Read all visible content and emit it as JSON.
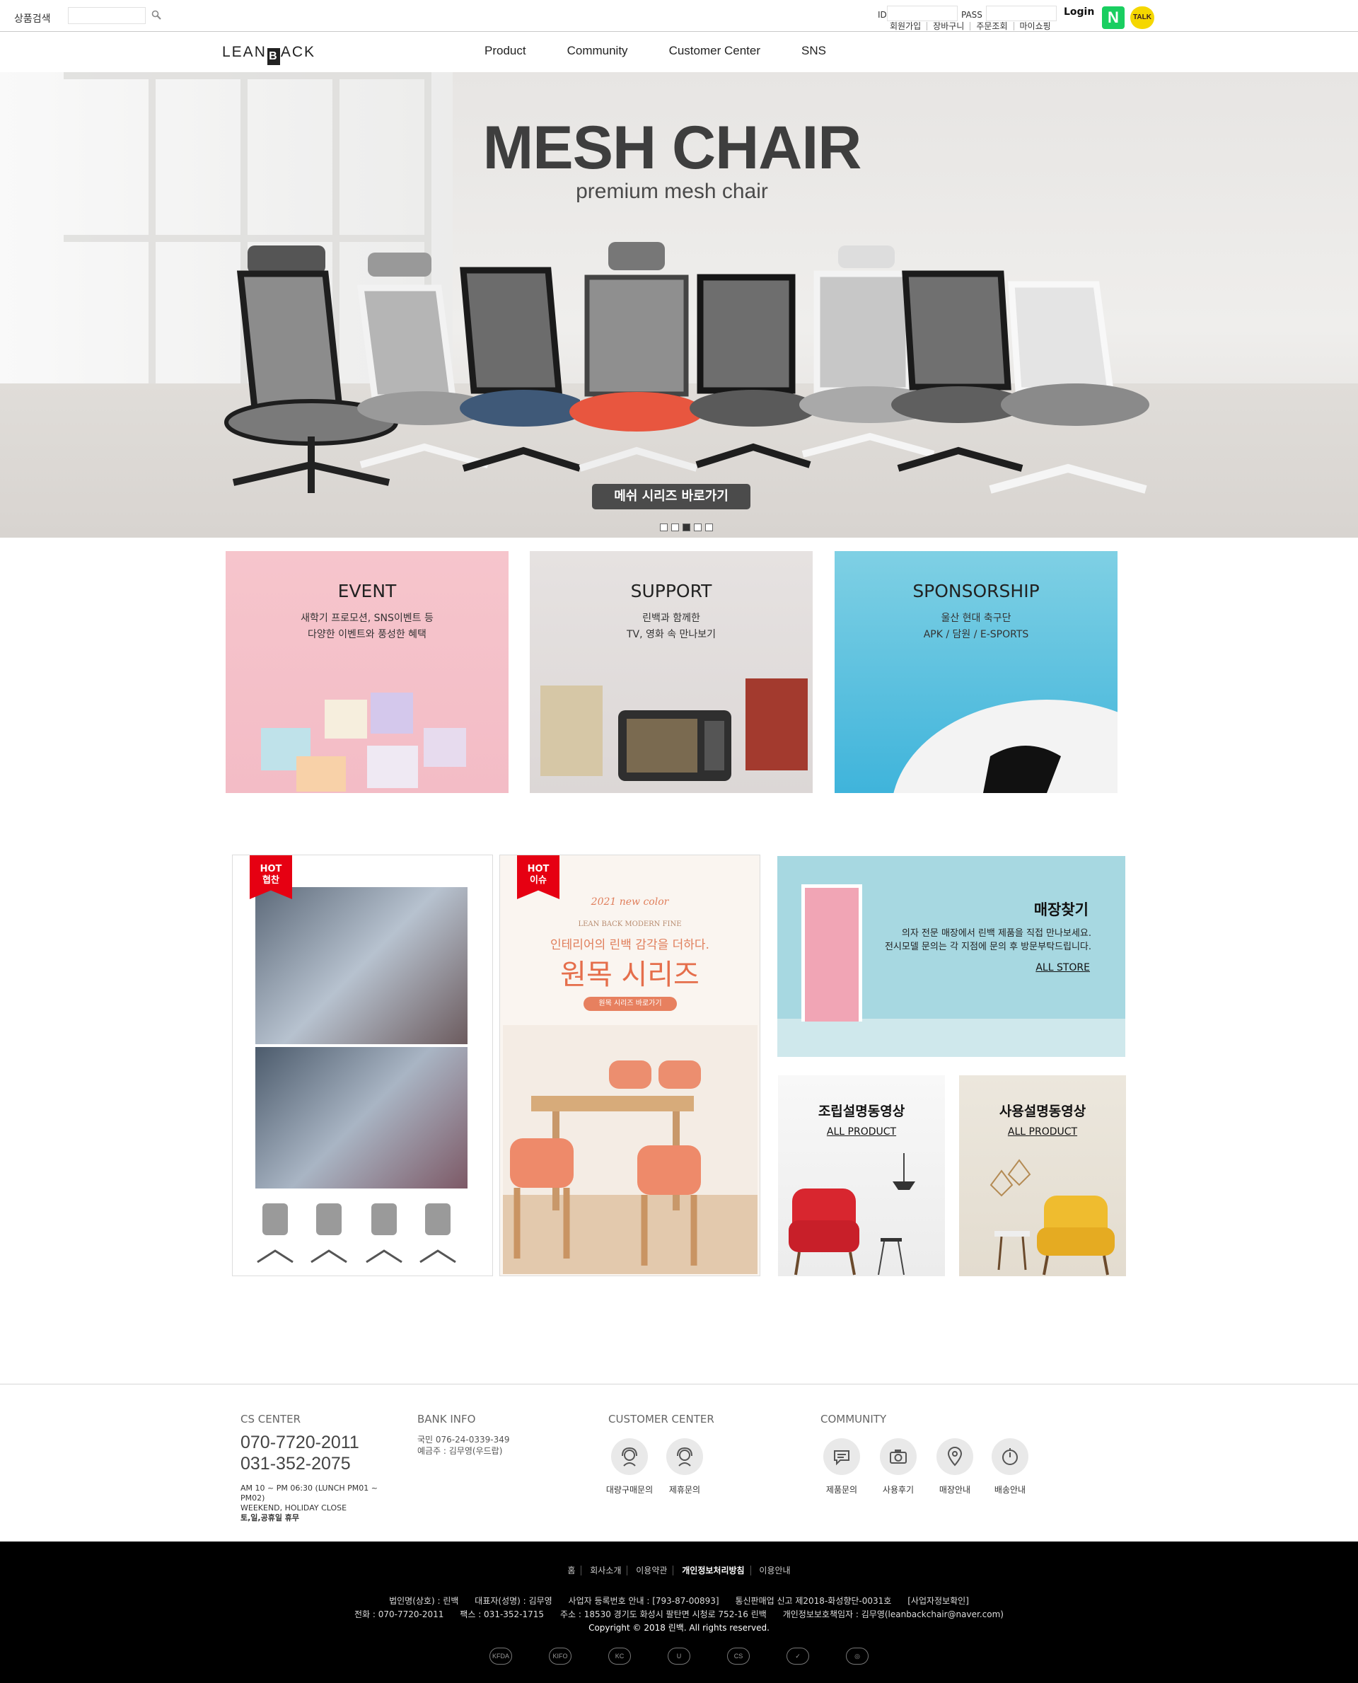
{
  "topbar": {
    "search_label": "상품검색",
    "id_label": "ID",
    "pass_label": "PASS",
    "login_label": "Login",
    "links": [
      "회원가입",
      "장바구니",
      "주문조회",
      "마이쇼핑"
    ],
    "naver_glyph": "N",
    "kakao_glyph": "TALK"
  },
  "nav": {
    "logo_left": "LEAN",
    "logo_mark": "B",
    "logo_right": "ACK",
    "menu": [
      "Product",
      "Community",
      "Customer Center",
      "SNS"
    ]
  },
  "hero": {
    "title": "MESH CHAIR",
    "subtitle": "premium mesh chair",
    "cta": "메쉬 시리즈 바로가기",
    "slides": 5,
    "active_slide": 3
  },
  "promos": [
    {
      "title": "EVENT",
      "desc1": "새학기 프로모션, SNS이벤트 등",
      "desc2": "다양한 이벤트와 풍성한 혜택"
    },
    {
      "title": "SUPPORT",
      "desc1": "린백과 함께한",
      "desc2": "TV, 영화 속 만나보기"
    },
    {
      "title": "SPONSORSHIP",
      "desc1": "울산 현대 축구단",
      "desc2": "APK / 담원 / E-SPORTS"
    }
  ],
  "hot": [
    {
      "ribbon1": "HOT",
      "ribbon2": "협찬"
    },
    {
      "ribbon1": "HOT",
      "ribbon2": "이슈"
    }
  ],
  "hot2_content": {
    "tag": "2021 new color",
    "brand": "LEAN BACK MODERN FINE",
    "tagline": "인테리어의 린백 감각을 더하다.",
    "title": "원목 시리즈",
    "button": "원목 시리즈 바로가기"
  },
  "store": {
    "title": "매장찾기",
    "desc1": "의자 전문 매장에서 린백 제품을 직접 만나보세요.",
    "desc2": "전시모델 문의는 각 지점에 문의 후 방문부탁드립니다.",
    "link": "ALL STORE"
  },
  "videos": [
    {
      "title": "조립설명동영상",
      "link": "ALL PRODUCT"
    },
    {
      "title": "사용설명동영상",
      "link": "ALL PRODUCT"
    }
  ],
  "footer": {
    "cs_heading": "CS CENTER",
    "phone1": "070-7720-2011",
    "phone2": "031-352-2075",
    "hours1": "AM 10 ~ PM 06:30 (LUNCH PM01 ~ PM02)",
    "hours2": "WEEKEND, HOLIDAY CLOSE",
    "hours3": "토,일,공휴일 휴무",
    "bank_heading": "BANK INFO",
    "bank1": "국민 076-24-0339-349",
    "bank2": "예금주 : 김무영(우드랍)",
    "customer_heading": "CUSTOMER CENTER",
    "customer_items": [
      "대량구매문의",
      "제휴문의"
    ],
    "community_heading": "COMMUNITY",
    "community_items": [
      "제품문의",
      "사용후기",
      "매장안내",
      "배송안내"
    ],
    "links": [
      "홈",
      "회사소개",
      "이용약관",
      "개인정보처리방침",
      "이용안내"
    ],
    "info_line1": "법인명(상호) : 린백      대표자(성명) : 김무영      사업자 등록번호 안내 : [793-87-00893]      통신판매업 신고 제2018-화성향단-0031호      [사업자정보확인]",
    "info_line2": "전화 : 070-7720-2011      팩스 : 031-352-1715      주소 : 18530 경기도 화성시 팔탄면 시청로 752-16 린백      개인정보보호책임자 : 김무영(leanbackchair@naver.com)",
    "copyright": "Copyright © 2018 린백. All rights reserved.",
    "marks": [
      "KFDA",
      "KIFO",
      "KC",
      "U",
      "CS",
      "✓",
      "◎"
    ]
  },
  "colors": {
    "hot_ribbon": "#e60012",
    "naver": "#19ce60",
    "kakao": "#f5d700",
    "footer_bg": "#000000"
  }
}
